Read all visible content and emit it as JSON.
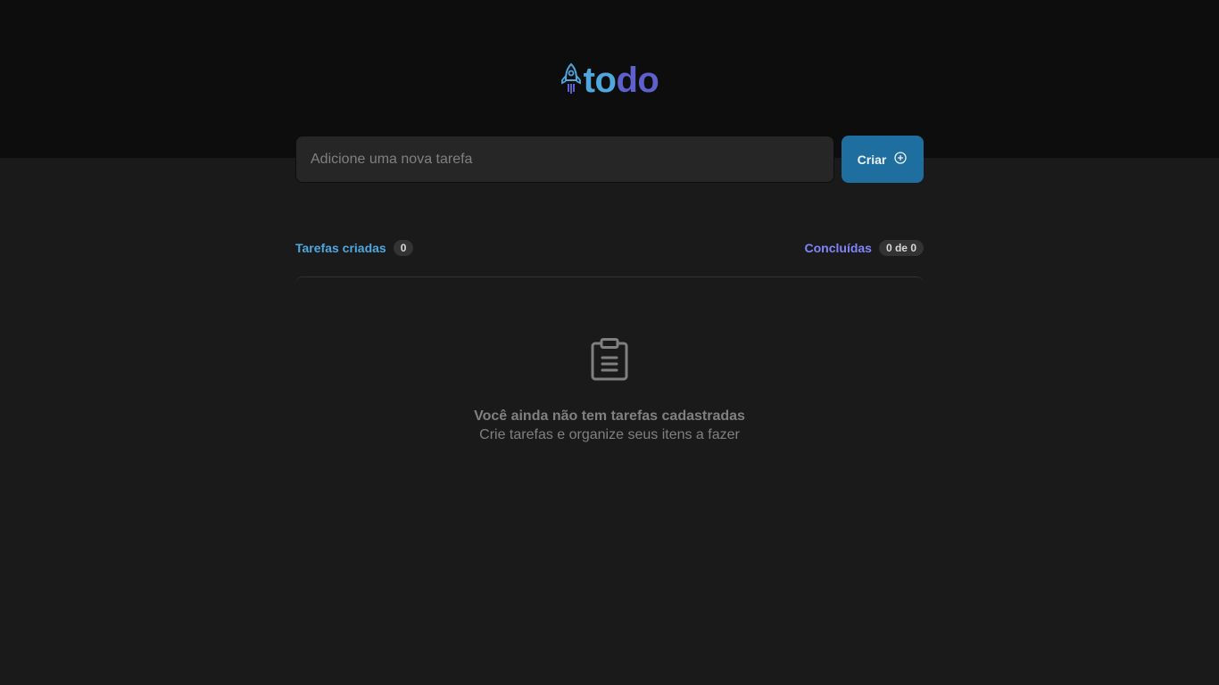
{
  "header": {
    "logo_part1": "to",
    "logo_part2": "do",
    "logo_icon": "rocket-icon"
  },
  "form": {
    "placeholder": "Adicione uma nova tarefa",
    "value": "",
    "create_label": "Criar",
    "create_icon": "plus-circle-icon"
  },
  "stats": {
    "created_label": "Tarefas criadas",
    "created_count": "0",
    "done_label": "Concluídas",
    "done_count": "0 de 0"
  },
  "empty_state": {
    "icon": "clipboard-icon",
    "title": "Você ainda não tem tarefas cadastradas",
    "subtitle": "Crie tarefas e organize seus itens a fazer"
  },
  "colors": {
    "blue": "#4ea8de",
    "purple": "#5e60ce",
    "purple_light": "#8284fa",
    "button": "#1e6f9f",
    "background": "#1a1a1a",
    "header_bg": "#0d0d0d"
  }
}
